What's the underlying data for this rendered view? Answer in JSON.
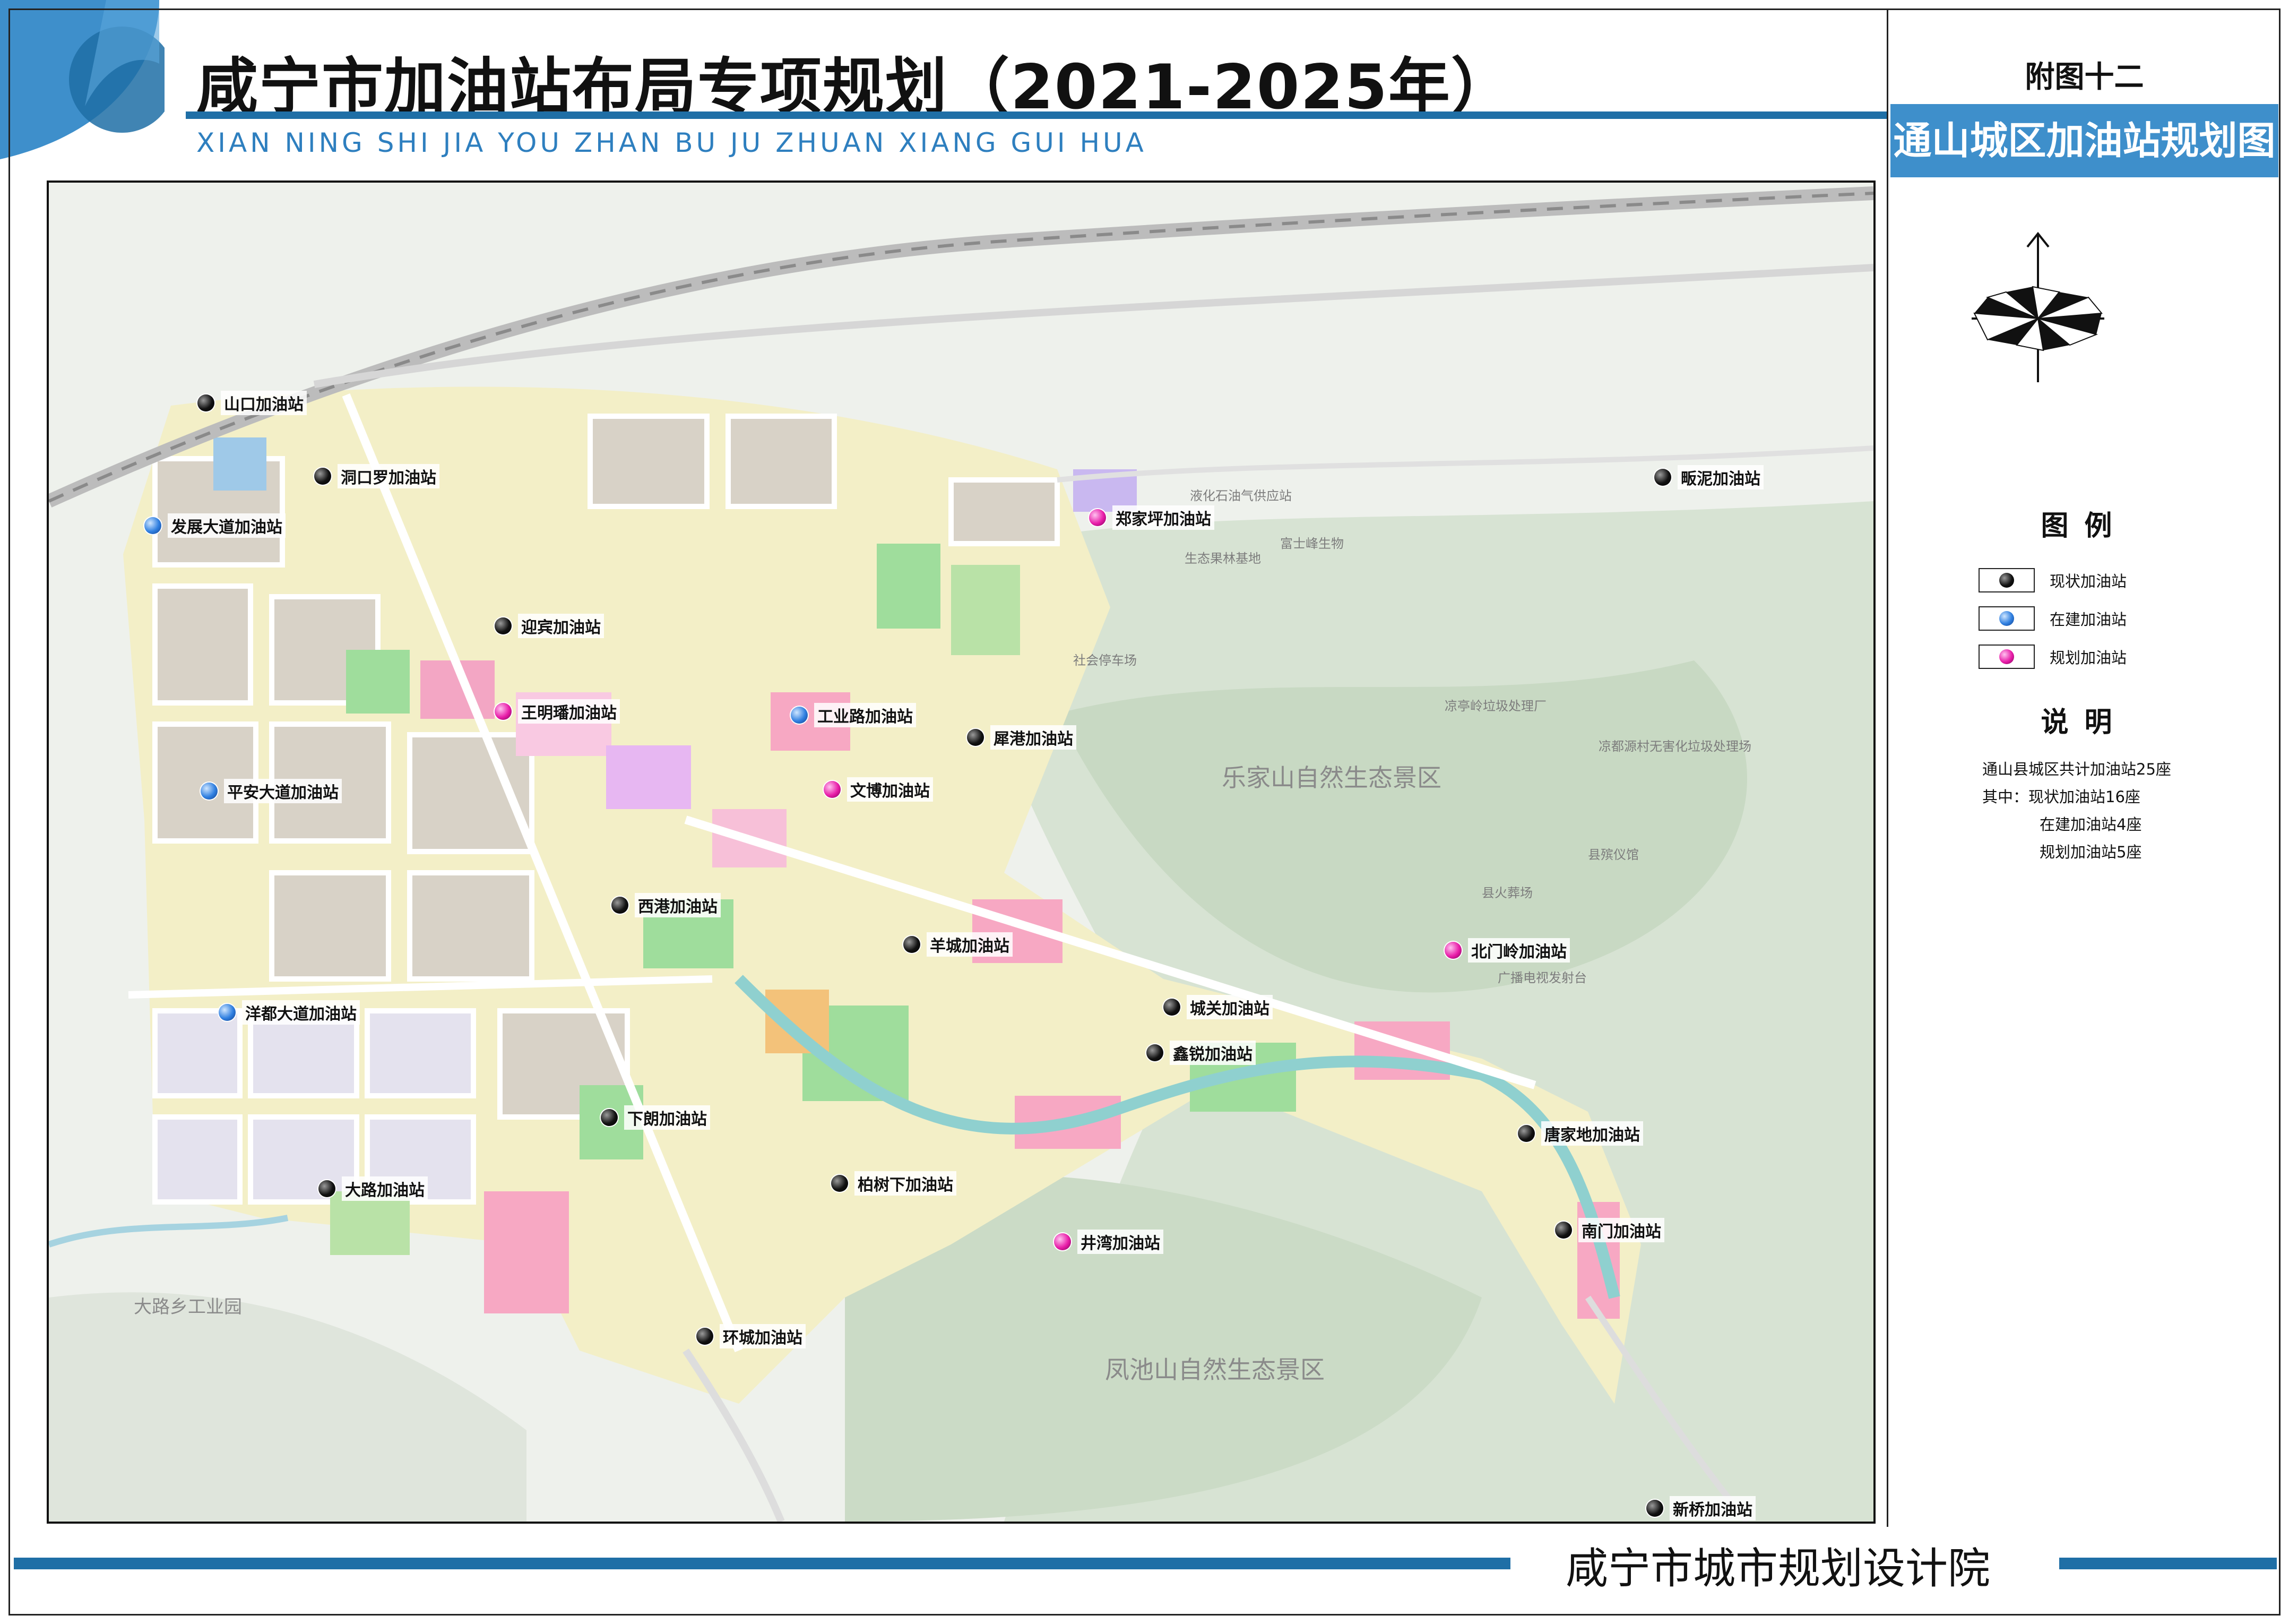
{
  "header": {
    "title": "咸宁市加油站布局专项规划（2021-2025年）",
    "subtitle": "XIAN NING SHI JIA YOU ZHAN BU JU ZHUAN XIANG GUI HUA"
  },
  "sidebar": {
    "plate_number": "附图十二",
    "plate_title": "通山城区加油站规划图"
  },
  "legend": {
    "title": "图例",
    "items": [
      {
        "label": "现状加油站",
        "type": "existing"
      },
      {
        "label": "在建加油站",
        "type": "building"
      },
      {
        "label": "规划加油站",
        "type": "planned"
      }
    ]
  },
  "description": {
    "title": "说明",
    "lines": [
      "通山县城区共计加油站25座",
      "其中：现状加油站16座",
      "在建加油站4座",
      "规划加油站5座"
    ]
  },
  "footer": {
    "institute": "咸宁市城市规划设计院"
  },
  "colors": {
    "existing": "#111111",
    "building": "#2f7fe0",
    "planned": "#e81ca8",
    "accent": "#1f6fa6",
    "panel": "#3e8fcb"
  },
  "map": {
    "areas": [
      {
        "label": "乐家山自然生态景区"
      },
      {
        "label": "凤池山自然生态景区"
      },
      {
        "label": "大路乡工业园"
      }
    ],
    "landmarks": [
      {
        "label": "液化石油气供应站"
      },
      {
        "label": "生态果林基地"
      },
      {
        "label": "富士峰生物"
      },
      {
        "label": "社会停车场"
      },
      {
        "label": "凉亭岭垃圾处理厂"
      },
      {
        "label": "凉都源村无害化垃圾处理场"
      },
      {
        "label": "县殡仪馆"
      },
      {
        "label": "县火葬场"
      },
      {
        "label": "广播电视发射台"
      }
    ],
    "stations": [
      {
        "name": "山口加油站",
        "type": "existing"
      },
      {
        "name": "洞口罗加油站",
        "type": "existing"
      },
      {
        "name": "发展大道加油站",
        "type": "building"
      },
      {
        "name": "迎宾加油站",
        "type": "existing"
      },
      {
        "name": "王明璠加油站",
        "type": "planned"
      },
      {
        "name": "工业路加油站",
        "type": "building"
      },
      {
        "name": "犀港加油站",
        "type": "existing"
      },
      {
        "name": "文博加油站",
        "type": "planned"
      },
      {
        "name": "平安大道加油站",
        "type": "building"
      },
      {
        "name": "西港加油站",
        "type": "existing"
      },
      {
        "name": "羊城加油站",
        "type": "existing"
      },
      {
        "name": "洋都大道加油站",
        "type": "building"
      },
      {
        "name": "城关加油站",
        "type": "existing"
      },
      {
        "name": "鑫锐加油站",
        "type": "existing"
      },
      {
        "name": "北门岭加油站",
        "type": "planned"
      },
      {
        "name": "下朗加油站",
        "type": "existing"
      },
      {
        "name": "唐家地加油站",
        "type": "existing"
      },
      {
        "name": "柏树下加油站",
        "type": "existing"
      },
      {
        "name": "大路加油站",
        "type": "existing"
      },
      {
        "name": "南门加油站",
        "type": "existing"
      },
      {
        "name": "井湾加油站",
        "type": "planned"
      },
      {
        "name": "环城加油站",
        "type": "existing"
      },
      {
        "name": "新桥加油站",
        "type": "existing"
      },
      {
        "name": "郑家坪加油站",
        "type": "planned"
      },
      {
        "name": "畈泥加油站",
        "type": "existing"
      }
    ]
  }
}
